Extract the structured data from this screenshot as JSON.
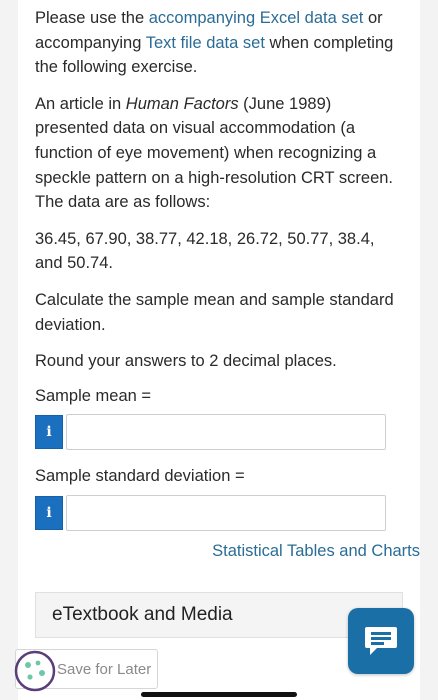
{
  "intro": {
    "prefix": "Please use the ",
    "excel_link": "accompanying Excel data set",
    "middle": " or accompanying ",
    "text_link": "Text file data set",
    "suffix": " when completing the following exercise."
  },
  "article": {
    "prefix": "An article in ",
    "journal": "Human Factors",
    "suffix": " (June 1989) presented data on visual accommodation (a function of eye movement) when recognizing a speckle pattern on a high-resolution CRT screen. The data are as follows:"
  },
  "data_values": "36.45, 67.90, 38.77, 42.18, 26.72, 50.77, 38.4, and 50.74.",
  "calc_instruction": "Calculate the sample mean and sample standard deviation.",
  "round_instruction": "Round your answers to 2 decimal places.",
  "fields": {
    "mean_label": "Sample mean =",
    "sd_label": "Sample standard deviation =",
    "info_glyph": "i"
  },
  "links": {
    "tables": "Statistical Tables and Charts"
  },
  "etextbook": "eTextbook and Media",
  "save_label": "Save for Later",
  "colors": {
    "link": "#2a6c96",
    "info_button": "#1a6fbf",
    "chat_button": "#1a6fa6"
  },
  "icons": {
    "info": "info-icon",
    "chat": "chat-icon",
    "cookie": "cookie-icon"
  }
}
